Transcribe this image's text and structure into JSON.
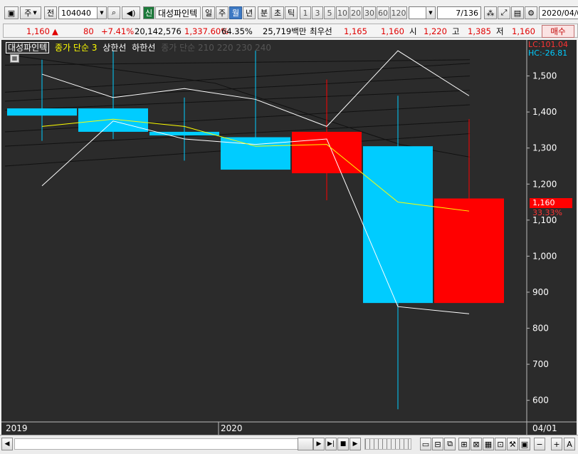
{
  "toolbar": {
    "period_label": "주",
    "prev_label": "전",
    "code": "104040",
    "stock_badge": "신",
    "stock_name": "대성파인텍",
    "periods": [
      "일",
      "주",
      "월",
      "년"
    ],
    "active_period": "월",
    "minute_tabs": [
      "분",
      "초",
      "틱"
    ],
    "intervals": [
      "1",
      "3",
      "5",
      "10",
      "20",
      "30",
      "60",
      "120"
    ],
    "page_value": "7",
    "page_total": "/136",
    "date": "2020/04/0"
  },
  "quote": {
    "price": "1,160",
    "change_arrow": "▲",
    "change": "80",
    "change_pct": "+7.41%",
    "volume": "20,142,576",
    "volume_ratio": "1,337.60%",
    "turnover": "64.35%",
    "amount": "25,719백만",
    "best_label": "최우선",
    "best_ask": "1,165",
    "best_bid": "1,160",
    "open_label": "시",
    "open": "1,220",
    "high_label": "고",
    "high": "1,385",
    "low_label": "저",
    "low": "1,160",
    "buy_label": "매수"
  },
  "legend": {
    "stock": "대성파인텍",
    "ma_label": "종가 단순 3",
    "upper_label": "상한선",
    "lower_label": "하한선",
    "ma_group": "종가 단순 210 220 230 240"
  },
  "axis": {
    "lc": "LC:101.04",
    "hc": "HC:-26.81",
    "price_tag": "1,160",
    "price_tag_pct": "33.33%",
    "x_labels": [
      "2019",
      "2020",
      "04/01"
    ]
  },
  "colors": {
    "up": "#ff0000",
    "down": "#00ccff",
    "ma": "#ffff00",
    "band": "#ffffff",
    "bg": "#2b2b2b"
  },
  "chart_data": {
    "type": "candlestick",
    "y_ticks": [
      1500,
      1400,
      1300,
      1200,
      1100,
      1000,
      900,
      800,
      700,
      600
    ],
    "ylim": [
      540,
      1600
    ],
    "candles": [
      {
        "o": 1410,
        "h": 1545,
        "l": 1320,
        "c": 1390,
        "dir": "down"
      },
      {
        "o": 1410,
        "h": 1570,
        "l": 1325,
        "c": 1345,
        "dir": "down"
      },
      {
        "o": 1345,
        "h": 1440,
        "l": 1265,
        "c": 1335,
        "dir": "down"
      },
      {
        "o": 1330,
        "h": 1570,
        "l": 1295,
        "c": 1240,
        "dir": "down"
      },
      {
        "o": 1230,
        "h": 1490,
        "l": 1155,
        "c": 1345,
        "dir": "up"
      },
      {
        "o": 1305,
        "h": 1445,
        "l": 575,
        "c": 870,
        "dir": "down"
      },
      {
        "o": 870,
        "h": 1380,
        "l": 870,
        "c": 1160,
        "dir": "up"
      }
    ],
    "ma3": [
      1360,
      1380,
      1360,
      1305,
      1310,
      1150,
      1125
    ],
    "upper_band": [
      1505,
      1440,
      1465,
      1435,
      1360,
      1570,
      1445
    ],
    "lower_band": [
      1195,
      1375,
      1325,
      1310,
      1325,
      860,
      840
    ]
  }
}
